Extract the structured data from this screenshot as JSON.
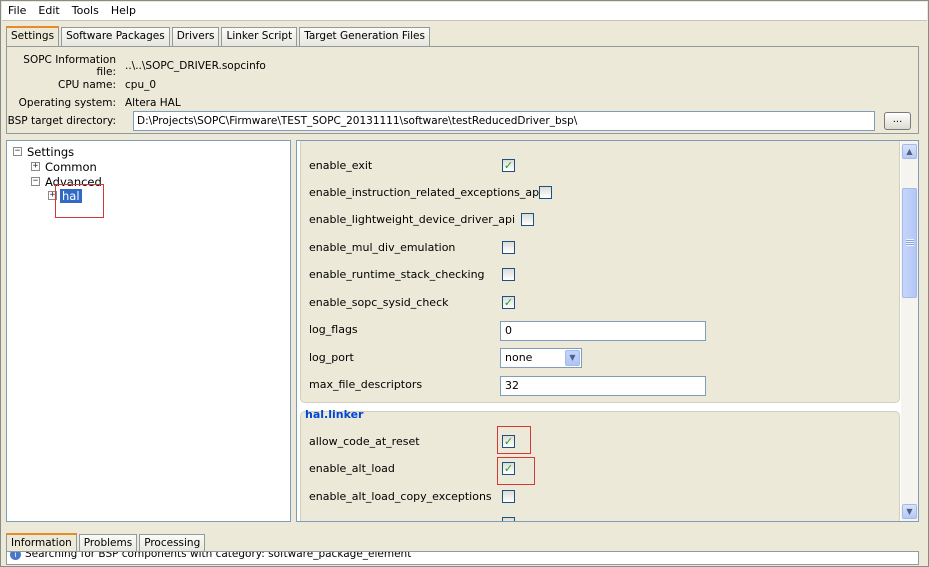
{
  "menu": [
    "File",
    "Edit",
    "Tools",
    "Help"
  ],
  "tabs": [
    "Settings",
    "Software Packages",
    "Drivers",
    "Linker Script",
    "Target Generation Files"
  ],
  "info": {
    "sopc_label": "SOPC Information file:",
    "sopc_value": "..\\..\\SOPC_DRIVER.sopcinfo",
    "cpu_label": "CPU name:",
    "cpu_value": "cpu_0",
    "os_label": "Operating system:",
    "os_value": "Altera HAL",
    "bsp_label": "BSP target directory:",
    "bsp_value": "D:\\Projects\\SOPC\\Firmware\\TEST_SOPC_20131111\\software\\testReducedDriver_bsp\\",
    "browse_label": "..."
  },
  "tree": {
    "root": "Settings",
    "common": "Common",
    "advanced": "Advanced",
    "hal": "hal",
    "collapsed_glyph": "+",
    "expanded_glyph": "−"
  },
  "settings": {
    "enable_exit": "enable_exit",
    "enable_instruction_related_exceptions_api": "enable_instruction_related_exceptions_api",
    "enable_lightweight_device_driver_api": "enable_lightweight_device_driver_api",
    "enable_mul_div_emulation": "enable_mul_div_emulation",
    "enable_runtime_stack_checking": "enable_runtime_stack_checking",
    "enable_sopc_sysid_check": "enable_sopc_sysid_check",
    "log_flags": "log_flags",
    "log_flags_value": "0",
    "log_port": "log_port",
    "log_port_value": "none",
    "max_file_descriptors": "max_file_descriptors",
    "max_file_descriptors_value": "32",
    "check_glyph": "✓",
    "checked": {
      "enable_exit": true,
      "enable_instruction_related_exceptions_api": false,
      "enable_lightweight_device_driver_api": false,
      "enable_mul_div_emulation": false,
      "enable_runtime_stack_checking": false,
      "enable_sopc_sysid_check": true
    }
  },
  "linker": {
    "title": "hal.linker",
    "allow_code_at_reset": "allow_code_at_reset",
    "enable_alt_load": "enable_alt_load",
    "enable_alt_load_copy_exceptions": "enable_alt_load_copy_exceptions",
    "checked": {
      "allow_code_at_reset": true,
      "enable_alt_load": true,
      "enable_alt_load_copy_exceptions": false
    }
  },
  "bottom_tabs": [
    "Information",
    "Problems",
    "Processing"
  ],
  "status": {
    "icon": "i",
    "text": "Searching for BSP components with category: software_package_element"
  },
  "icons": {
    "scroll_up": "▲",
    "scroll_down": "▼",
    "dropdown": "▼"
  },
  "colors": {
    "accent_tab": "#e68b2c",
    "selection": "#316ac5",
    "group_title": "#0046d5",
    "annotation_red": "#d23a3a",
    "checkmark": "#21a121"
  }
}
